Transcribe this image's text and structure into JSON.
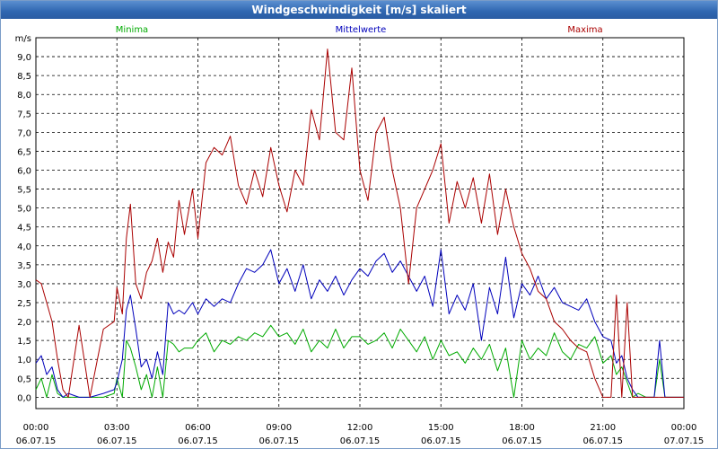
{
  "window": {
    "title": "Windgeschwindigkeit [m/s] skaliert"
  },
  "chart_data": {
    "type": "line",
    "title": "Windgeschwindigkeit [m/s] skaliert",
    "ylabel": "m/s",
    "ylim": [
      -0.3,
      9.5
    ],
    "xlim": [
      0,
      24
    ],
    "grid": true,
    "legend_position": "top",
    "yticks": [
      "0,0",
      "0,5",
      "1,0",
      "1,5",
      "2,0",
      "2,5",
      "3,0",
      "3,5",
      "4,0",
      "4,5",
      "5,0",
      "5,5",
      "6,0",
      "6,5",
      "7,0",
      "7,5",
      "8,0",
      "8,5",
      "9,0"
    ],
    "xticks": [
      {
        "time": "00:00",
        "date": "06.07.15"
      },
      {
        "time": "03:00",
        "date": "06.07.15"
      },
      {
        "time": "06:00",
        "date": "06.07.15"
      },
      {
        "time": "09:00",
        "date": "06.07.15"
      },
      {
        "time": "12:00",
        "date": "06.07.15"
      },
      {
        "time": "15:00",
        "date": "06.07.15"
      },
      {
        "time": "18:00",
        "date": "06.07.15"
      },
      {
        "time": "21:00",
        "date": "06.07.15"
      },
      {
        "time": "00:00",
        "date": "07.07.15"
      }
    ],
    "series": [
      {
        "name": "Minima",
        "color": "#00aa00",
        "x": [
          0,
          0.2,
          0.4,
          0.6,
          0.8,
          1.0,
          1.2,
          1.6,
          2.0,
          2.5,
          2.9,
          3.0,
          3.2,
          3.35,
          3.5,
          3.7,
          3.9,
          4.1,
          4.3,
          4.5,
          4.7,
          4.9,
          5.1,
          5.3,
          5.5,
          5.8,
          6.0,
          6.3,
          6.6,
          6.9,
          7.2,
          7.5,
          7.8,
          8.1,
          8.4,
          8.7,
          9.0,
          9.3,
          9.6,
          9.9,
          10.2,
          10.5,
          10.8,
          11.1,
          11.4,
          11.7,
          12.0,
          12.3,
          12.6,
          12.9,
          13.2,
          13.5,
          13.8,
          14.1,
          14.4,
          14.7,
          15.0,
          15.3,
          15.6,
          15.9,
          16.2,
          16.5,
          16.8,
          17.1,
          17.4,
          17.7,
          18.0,
          18.3,
          18.6,
          18.9,
          19.2,
          19.5,
          19.8,
          20.1,
          20.4,
          20.7,
          21.0,
          21.3,
          21.5,
          21.7,
          21.9,
          22.1,
          22.3,
          22.6,
          22.9,
          23.1,
          23.3,
          23.5,
          23.7,
          23.9,
          24.0
        ],
        "values": [
          0.2,
          0.5,
          0.0,
          0.6,
          0.1,
          0.0,
          0.0,
          0.0,
          0.0,
          0.0,
          0.1,
          0.5,
          0.0,
          1.5,
          1.3,
          0.8,
          0.2,
          0.6,
          0.0,
          0.8,
          0.0,
          1.5,
          1.4,
          1.2,
          1.3,
          1.3,
          1.5,
          1.7,
          1.2,
          1.5,
          1.4,
          1.6,
          1.5,
          1.7,
          1.6,
          1.9,
          1.6,
          1.7,
          1.4,
          1.8,
          1.2,
          1.5,
          1.3,
          1.8,
          1.3,
          1.6,
          1.6,
          1.4,
          1.5,
          1.7,
          1.3,
          1.8,
          1.5,
          1.2,
          1.6,
          1.0,
          1.5,
          1.1,
          1.2,
          0.9,
          1.3,
          1.0,
          1.4,
          0.7,
          1.3,
          0.0,
          1.5,
          1.0,
          1.3,
          1.1,
          1.7,
          1.2,
          1.0,
          1.4,
          1.3,
          1.6,
          0.9,
          1.1,
          0.6,
          0.8,
          0.4,
          0.0,
          0.1,
          0.0,
          0.0,
          1.0,
          0.0,
          0.0,
          0.0,
          0.0,
          0.0
        ]
      },
      {
        "name": "Mittelwerte",
        "color": "#0000bb",
        "x": [
          0,
          0.2,
          0.4,
          0.6,
          0.8,
          1.0,
          1.2,
          1.6,
          2.0,
          2.5,
          2.9,
          3.0,
          3.2,
          3.35,
          3.5,
          3.7,
          3.9,
          4.1,
          4.3,
          4.5,
          4.7,
          4.9,
          5.1,
          5.3,
          5.5,
          5.8,
          6.0,
          6.3,
          6.6,
          6.9,
          7.2,
          7.5,
          7.8,
          8.1,
          8.4,
          8.7,
          9.0,
          9.3,
          9.6,
          9.9,
          10.2,
          10.5,
          10.8,
          11.1,
          11.4,
          11.7,
          12.0,
          12.3,
          12.6,
          12.9,
          13.2,
          13.5,
          13.8,
          14.1,
          14.4,
          14.7,
          15.0,
          15.3,
          15.6,
          15.9,
          16.2,
          16.5,
          16.8,
          17.1,
          17.4,
          17.7,
          18.0,
          18.3,
          18.6,
          18.9,
          19.2,
          19.5,
          19.8,
          20.1,
          20.4,
          20.7,
          21.0,
          21.3,
          21.5,
          21.7,
          21.9,
          22.1,
          22.3,
          22.6,
          22.9,
          23.1,
          23.3,
          23.5,
          23.7,
          23.9,
          24.0
        ],
        "values": [
          0.9,
          1.1,
          0.6,
          0.8,
          0.2,
          0.0,
          0.1,
          0.0,
          0.0,
          0.1,
          0.2,
          0.4,
          1.0,
          2.3,
          2.7,
          1.8,
          0.8,
          1.0,
          0.5,
          1.2,
          0.6,
          2.5,
          2.2,
          2.3,
          2.2,
          2.5,
          2.2,
          2.6,
          2.4,
          2.6,
          2.5,
          3.0,
          3.4,
          3.3,
          3.5,
          3.9,
          3.0,
          3.4,
          2.8,
          3.5,
          2.6,
          3.1,
          2.8,
          3.2,
          2.7,
          3.1,
          3.4,
          3.2,
          3.6,
          3.8,
          3.3,
          3.6,
          3.2,
          2.8,
          3.2,
          2.4,
          3.9,
          2.2,
          2.7,
          2.3,
          3.0,
          1.5,
          2.9,
          2.2,
          3.7,
          2.1,
          3.0,
          2.7,
          3.2,
          2.6,
          2.9,
          2.5,
          2.4,
          2.3,
          2.6,
          2.0,
          1.6,
          1.5,
          0.9,
          1.1,
          0.5,
          0.2,
          0.0,
          0.0,
          0.0,
          1.5,
          0.0,
          0.0,
          0.0,
          0.0,
          0.0
        ]
      },
      {
        "name": "Maxima",
        "color": "#aa0000",
        "x": [
          0,
          0.2,
          0.4,
          0.6,
          0.8,
          1.0,
          1.2,
          1.6,
          2.0,
          2.5,
          2.9,
          3.0,
          3.2,
          3.35,
          3.5,
          3.7,
          3.9,
          4.1,
          4.3,
          4.5,
          4.7,
          4.9,
          5.1,
          5.3,
          5.5,
          5.8,
          6.0,
          6.3,
          6.6,
          6.9,
          7.2,
          7.5,
          7.8,
          8.1,
          8.4,
          8.7,
          9.0,
          9.3,
          9.6,
          9.9,
          10.2,
          10.5,
          10.8,
          11.1,
          11.4,
          11.7,
          12.0,
          12.3,
          12.6,
          12.9,
          13.2,
          13.5,
          13.8,
          14.1,
          14.4,
          14.7,
          15.0,
          15.3,
          15.6,
          15.9,
          16.2,
          16.5,
          16.8,
          17.1,
          17.4,
          17.7,
          18.0,
          18.3,
          18.6,
          18.9,
          19.2,
          19.5,
          19.8,
          20.1,
          20.4,
          20.7,
          21.0,
          21.3,
          21.5,
          21.7,
          21.9,
          22.1,
          22.3,
          22.6,
          22.9,
          23.1,
          23.3,
          23.5,
          23.7,
          23.9,
          24.0
        ],
        "values": [
          3.1,
          3.0,
          2.5,
          2.0,
          1.0,
          0.2,
          0.0,
          1.9,
          0.0,
          1.8,
          2.0,
          2.9,
          2.2,
          4.2,
          5.1,
          3.0,
          2.6,
          3.3,
          3.6,
          4.2,
          3.3,
          4.1,
          3.7,
          5.2,
          4.3,
          5.5,
          4.2,
          6.2,
          6.6,
          6.4,
          6.9,
          5.6,
          5.1,
          6.0,
          5.3,
          6.6,
          5.6,
          4.9,
          6.0,
          5.6,
          7.6,
          6.8,
          9.2,
          7.0,
          6.8,
          8.7,
          6.0,
          5.2,
          7.0,
          7.4,
          6.0,
          5.0,
          3.0,
          5.0,
          5.5,
          6.0,
          6.7,
          4.6,
          5.7,
          5.0,
          5.8,
          4.6,
          5.9,
          4.3,
          5.5,
          4.5,
          3.8,
          3.4,
          2.8,
          2.6,
          2.0,
          1.8,
          1.5,
          1.3,
          1.2,
          0.5,
          0.0,
          0.0,
          2.7,
          0.0,
          2.5,
          0.0,
          0.0,
          0.0,
          0.0,
          0.0,
          0.0,
          0.0,
          0.0,
          0.0,
          0.0
        ]
      }
    ]
  }
}
